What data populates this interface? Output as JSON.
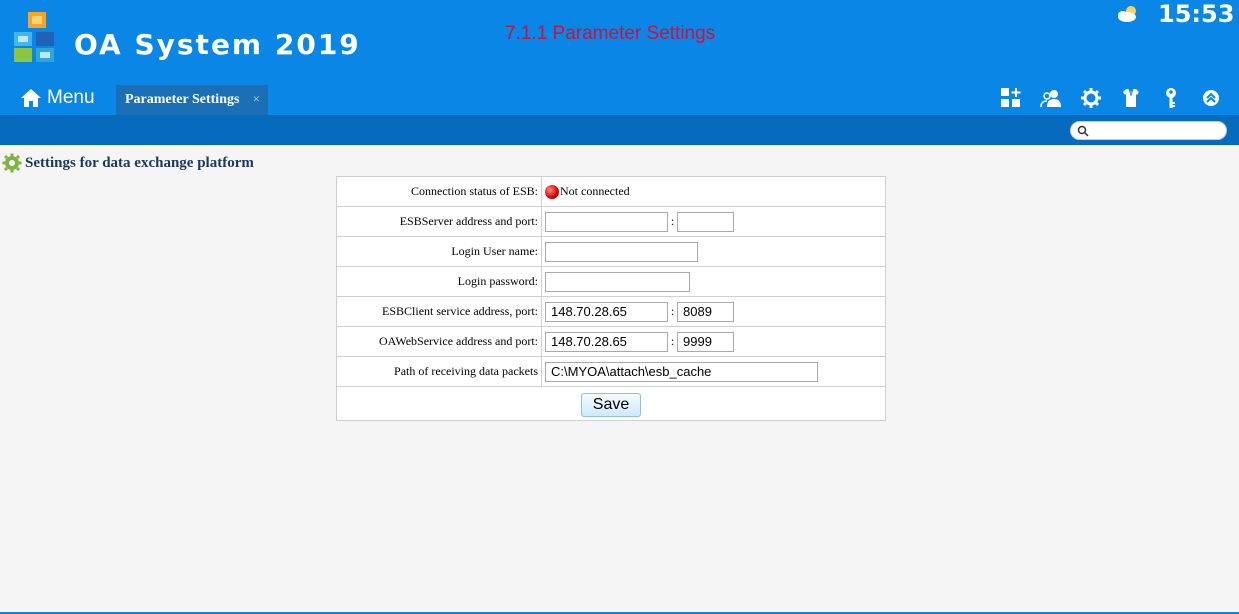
{
  "header": {
    "app_title": "OA System 2019",
    "page_heading": "7.1.1 Parameter Settings",
    "clock": "15:53",
    "weather_icon": "partly-cloudy-icon",
    "brand_color": "#0a86e6"
  },
  "nav": {
    "menu_label": "Menu",
    "active_tab": "Parameter Settings",
    "tab_close": "×",
    "toolbar_icons": [
      "add-widget-icon",
      "users-icon",
      "gear-icon",
      "shirt-icon",
      "key-icon",
      "collapse-up-icon"
    ]
  },
  "search": {
    "value": "",
    "placeholder": ""
  },
  "section": {
    "title": "Settings for data exchange platform"
  },
  "form": {
    "status": {
      "label": "Connection status of ESB:",
      "value": "Not connected",
      "color": "#d40000"
    },
    "esb_server": {
      "label": "ESBServer address and port:",
      "address": "",
      "port": ""
    },
    "login_user": {
      "label": "Login User name:",
      "value": ""
    },
    "login_password": {
      "label": "Login password:",
      "value": ""
    },
    "esb_client": {
      "label": "ESBClient service address, port:",
      "address": "148.70.28.65",
      "port": "8089"
    },
    "oa_webservice": {
      "label": "OAWebService address and port:",
      "address": "148.70.28.65",
      "port": "9999"
    },
    "receive_path": {
      "label": "Path of receiving data packets",
      "value": "C:\\MYOA\\attach\\esb_cache"
    },
    "colon": ":",
    "save_label": "Save"
  }
}
